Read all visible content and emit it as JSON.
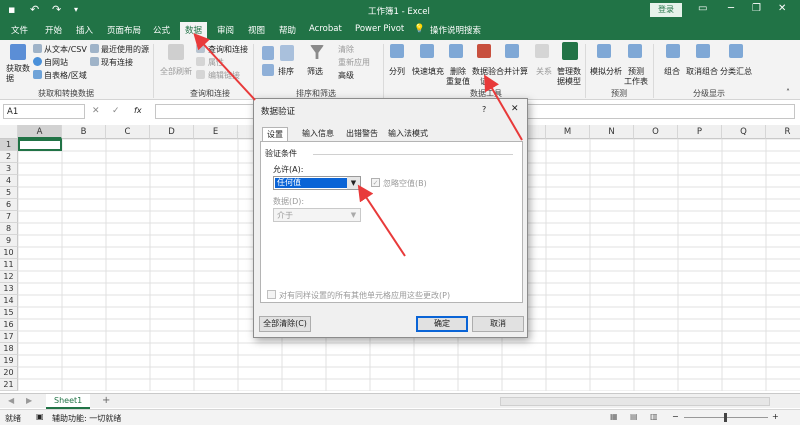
{
  "window": {
    "title": "工作簿1 - Excel",
    "login_label": "登录",
    "share_label": "共享"
  },
  "tabs": [
    {
      "label": "文件"
    },
    {
      "label": "开始"
    },
    {
      "label": "插入"
    },
    {
      "label": "页面布局"
    },
    {
      "label": "公式"
    },
    {
      "label": "数据"
    },
    {
      "label": "审阅"
    },
    {
      "label": "视图"
    },
    {
      "label": "帮助"
    },
    {
      "label": "Acrobat"
    },
    {
      "label": "Power Pivot"
    },
    {
      "label": "操作说明搜索"
    }
  ],
  "ribbon": {
    "get_data_label": "获取数\n据",
    "from_text_csv": "从文本/CSV",
    "from_web": "自网站",
    "from_table": "自表格/区域",
    "recent_sources": "最近使用的源",
    "existing_connections": "现有连接",
    "group_get_transform": "获取和转换数据",
    "refresh_all": "全部刷新",
    "queries_connections": "查询和连接",
    "properties": "属性",
    "edit_links": "编辑链接",
    "group_queries": "查询和连接",
    "sort_label": "排序",
    "filter_label": "筛选",
    "clear_label": "清除",
    "reapply_label": "重新应用",
    "advanced_label": "高级",
    "group_sort_filter": "排序和筛选",
    "text_to_columns": "分列",
    "flash_fill": "快速填充",
    "remove_duplicates_1": "删除",
    "remove_duplicates_2": "重复值",
    "data_validation_1": "数据验",
    "data_validation_2": "证",
    "consolidate": "合并计算",
    "relationships": "关系",
    "manage_data_model_1": "管理数",
    "manage_data_model_2": "据模型",
    "group_data_tools": "数据工具",
    "what_if": "模拟分析",
    "forecast_sheet_1": "预测",
    "forecast_sheet_2": "工作表",
    "group_forecast": "预测",
    "group": "组合",
    "ungroup": "取消组合",
    "subtotal": "分类汇总",
    "group_outline": "分级显示"
  },
  "formula_bar": {
    "name_box": "A1",
    "fx": "fx"
  },
  "grid": {
    "columns": [
      "A",
      "B",
      "C",
      "D",
      "E",
      "F",
      "G",
      "H",
      "I",
      "J",
      "K",
      "L",
      "M",
      "N",
      "O",
      "P",
      "Q",
      "R"
    ],
    "rows": [
      "1",
      "2",
      "3",
      "4",
      "5",
      "6",
      "7",
      "8",
      "9",
      "10",
      "11",
      "12",
      "13",
      "14",
      "15",
      "16",
      "17",
      "18",
      "19",
      "20",
      "21"
    ]
  },
  "sheet": {
    "tab_label": "Sheet1",
    "add_label": "+"
  },
  "status": {
    "ready": "就绪",
    "accessibility": "辅助功能: 一切就绪"
  },
  "dialog": {
    "title": "数据验证",
    "help": "?",
    "close": "✕",
    "tabs": [
      "设置",
      "输入信息",
      "出错警告",
      "输入法模式"
    ],
    "section_title": "验证条件",
    "allow_label": "允许(A):",
    "allow_value": "任何值",
    "ignore_blank": "忽略空值(B)",
    "data_label": "数据(D):",
    "data_value": "介于",
    "apply_all": "对有同样设置的所有其他单元格应用这些更改(P)",
    "clear_all": "全部清除(C)",
    "ok": "确定",
    "cancel": "取消"
  },
  "colors": {
    "excel_green": "#217346",
    "annotation_red": "#e83a3a",
    "selection_blue": "#0a64d6"
  }
}
